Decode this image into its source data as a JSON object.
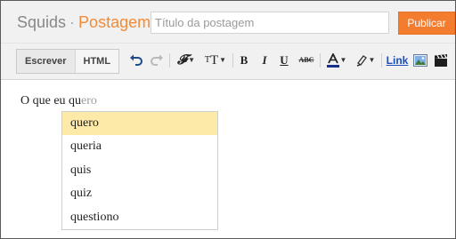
{
  "header": {
    "blog_name": "Squids",
    "separator": "·",
    "section": "Postagem",
    "title_placeholder": "Título da postagem",
    "publish_label": "Publicar"
  },
  "toolbar": {
    "modes": [
      "Escrever",
      "HTML"
    ],
    "active_mode": "Escrever",
    "link_label": "Link",
    "icons": [
      "undo-icon",
      "redo-icon",
      "font-family-icon",
      "font-size-icon",
      "bold-icon",
      "italic-icon",
      "underline-icon",
      "strikethrough-icon",
      "text-color-icon",
      "highlight-icon",
      "link",
      "image-icon",
      "video-icon"
    ]
  },
  "editor": {
    "typed_text": "O que eu qu",
    "ghost_text": "ero"
  },
  "suggestions": {
    "items": [
      "quero",
      "queria",
      "quis",
      "quiz",
      "questiono"
    ],
    "selected_index": 0
  },
  "colors": {
    "accent": "#f37c2f",
    "brand_section": "#f48a35",
    "selected_suggestion": "#fde9a8",
    "link": "#1a4fbd"
  }
}
